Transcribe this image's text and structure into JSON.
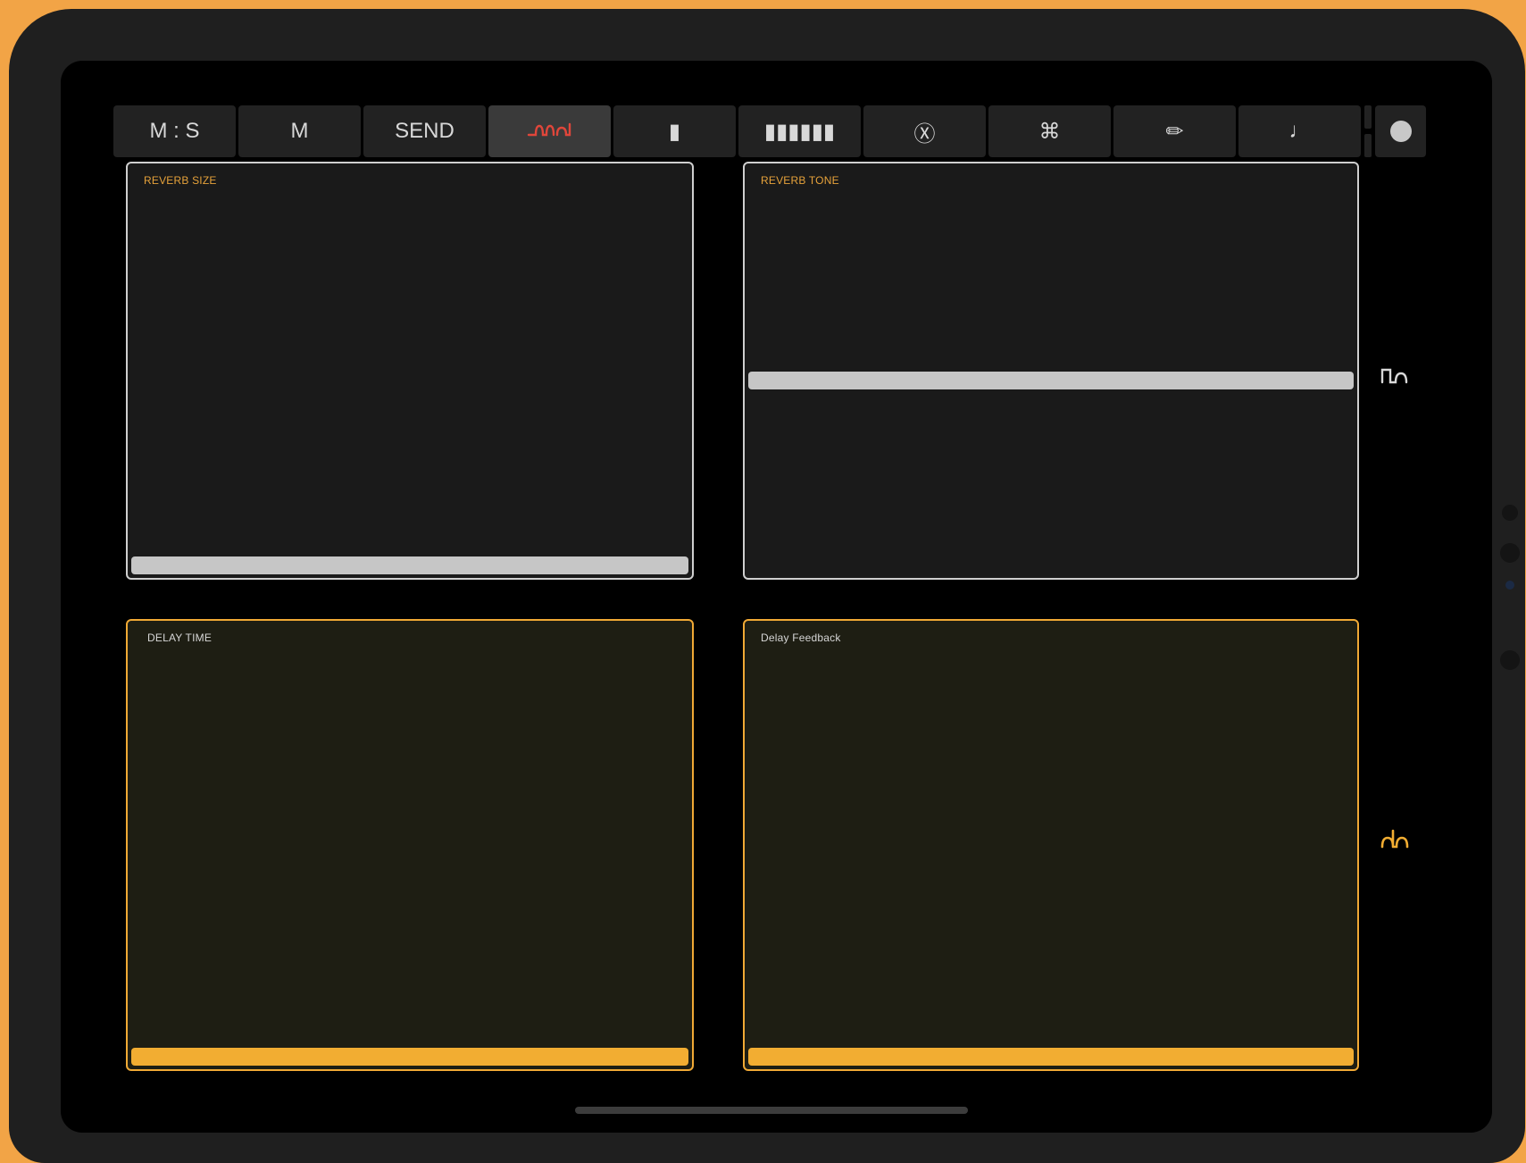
{
  "toolbar": {
    "buttons": [
      {
        "label": "M : S"
      },
      {
        "label": "M"
      },
      {
        "label": "SEND"
      },
      {
        "label": "ꭆꭅ"
      },
      {
        "label": "▮"
      },
      {
        "label": "▮▮▮▮▮▮"
      },
      {
        "label": "Ⓧ"
      },
      {
        "label": "⌘"
      },
      {
        "label": "✏"
      },
      {
        "label": "♩"
      }
    ],
    "active_index": 3
  },
  "pads": {
    "reverb_size": {
      "label": "REVERB SIZE",
      "value": 0.0
    },
    "reverb_tone": {
      "label": "REVERB TONE",
      "value": 0.5
    },
    "delay_time": {
      "label": "DELAY TIME",
      "value": 0.0
    },
    "delay_feedback": {
      "label": "Delay Feedback",
      "value": 0.0
    }
  },
  "side": {
    "top_glyph": "ꭆ",
    "bottom_glyph": "ꭅ"
  },
  "colors": {
    "accent_orange": "#f2ad32",
    "active_red": "#e0463a",
    "bezel_orange": "#f2a446"
  }
}
